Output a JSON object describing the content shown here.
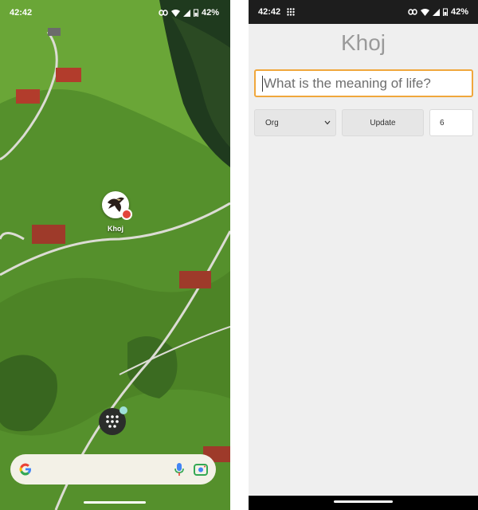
{
  "home_screen": {
    "status_bar": {
      "time": "42:42",
      "battery": "42%"
    },
    "app_shortcut": {
      "label": "Khoj",
      "icon": "eagle-logo-icon"
    },
    "dock_app": {
      "icon": "dots-grid-icon"
    },
    "search_bar": {
      "logo": "G",
      "mic_icon": "mic-icon",
      "lens_icon": "camera-lens-icon"
    }
  },
  "khoj_app": {
    "status_bar": {
      "time": "42:42",
      "battery": "42%"
    },
    "title": "Khoj",
    "search": {
      "placeholder": "What is the meaning of life?"
    },
    "controls": {
      "type_select": {
        "selected": "Org"
      },
      "update_label": "Update",
      "results_count": "6"
    }
  },
  "colors": {
    "accent": "#f0a73c",
    "app_background": "#efefef",
    "status_bar_dark": "#1d1d1d",
    "title_gray": "#9a9a9a"
  }
}
